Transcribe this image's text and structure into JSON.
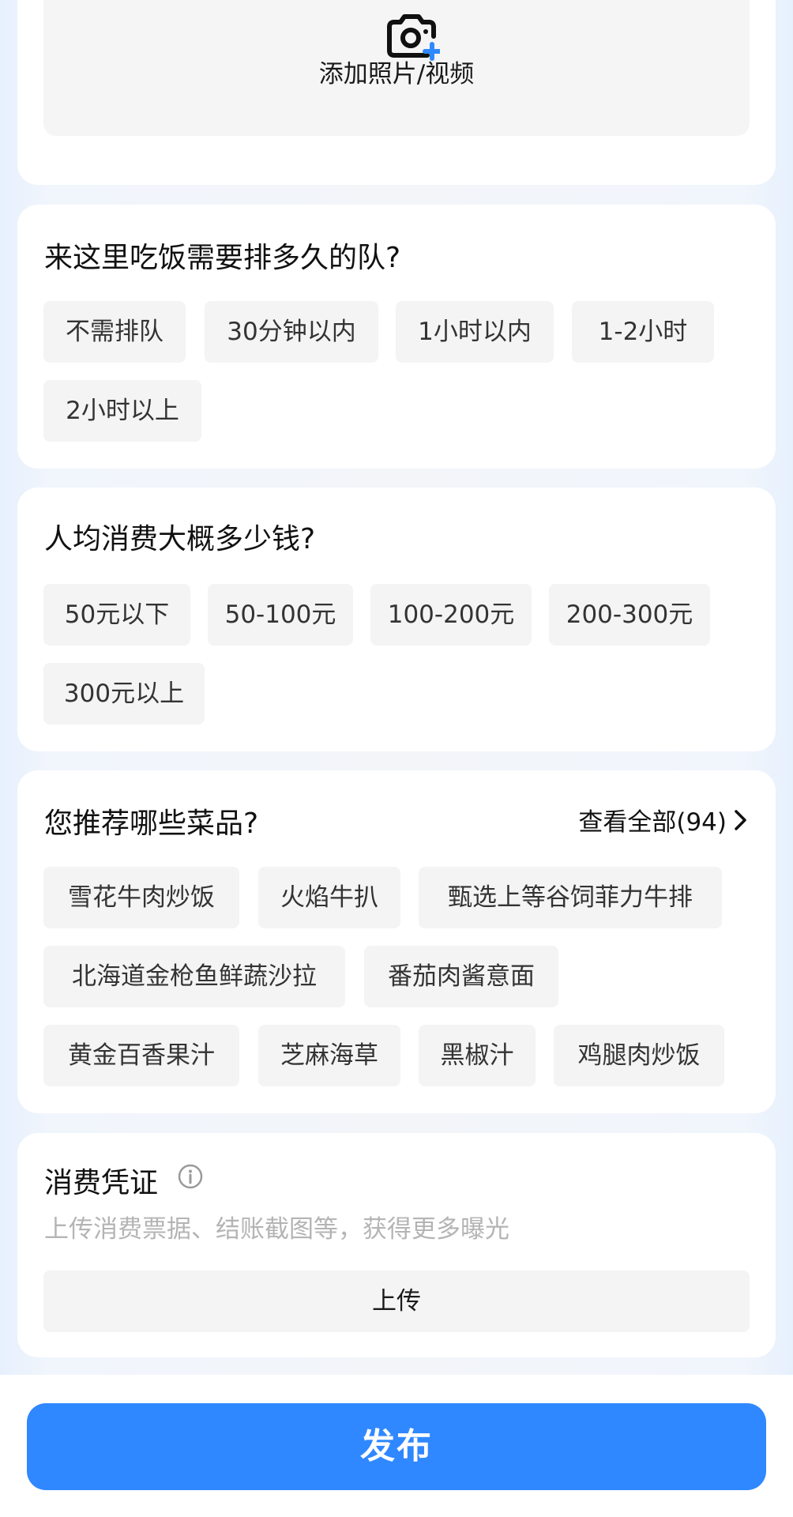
{
  "media": {
    "add_label": "添加照片/视频",
    "icon": "camera-plus-icon",
    "accent": "#2f88ff"
  },
  "queue": {
    "title": "来这里吃饭需要排多久的队?",
    "options": [
      "不需排队",
      "30分钟以内",
      "1小时以内",
      "1-2小时",
      "2小时以上"
    ]
  },
  "price": {
    "title": "人均消费大概多少钱?",
    "options": [
      "50元以下",
      "50-100元",
      "100-200元",
      "200-300元",
      "300元以上"
    ]
  },
  "dishes": {
    "title": "您推荐哪些菜品?",
    "see_all_label": "查看全部(94)",
    "options": [
      "雪花牛肉炒饭",
      "火焰牛扒",
      "甄选上等谷饲菲力牛排",
      "北海道金枪鱼鲜蔬沙拉",
      "番茄肉酱意面",
      "黄金百香果汁",
      "芝麻海草",
      "黑椒汁",
      "鸡腿肉炒饭"
    ]
  },
  "proof": {
    "title": "消费凭证",
    "hint": "上传消费票据、结账截图等，获得更多曝光",
    "upload_label": "上传",
    "icon": "info-icon"
  },
  "footer": {
    "publish_label": "发布",
    "button_color": "#2f88ff"
  }
}
